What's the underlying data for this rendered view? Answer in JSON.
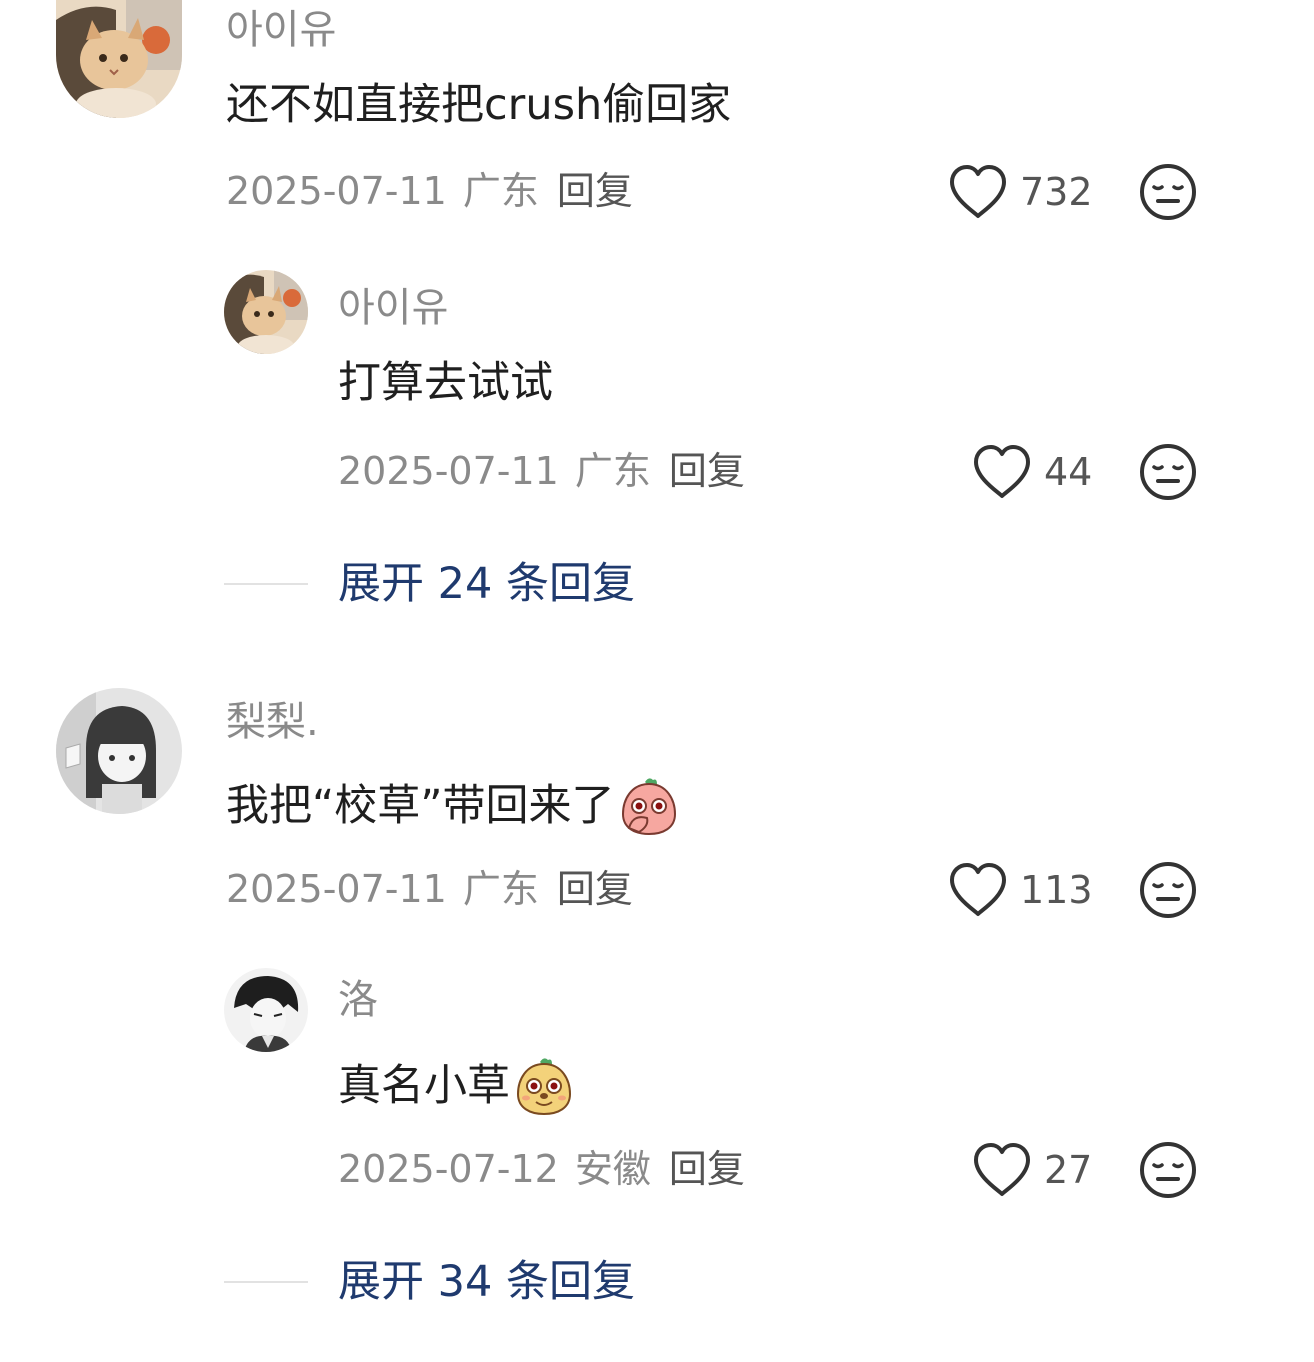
{
  "comments": [
    {
      "username": "아이유",
      "text": "还不如直接把crush偷回家",
      "date": "2025-07-11",
      "location": "广东",
      "reply_label": "回复",
      "likes": "732",
      "replies": [
        {
          "username": "아이유",
          "text": "打算去试试",
          "date": "2025-07-11",
          "location": "广东",
          "reply_label": "回复",
          "likes": "44"
        }
      ],
      "expand_label": "展开 24 条回复"
    },
    {
      "username": "梨梨.",
      "text": "我把“校草”带回来了",
      "emoji": "peach-cover-mouth-emoji",
      "date": "2025-07-11",
      "location": "广东",
      "reply_label": "回复",
      "likes": "113",
      "replies": [
        {
          "username": "洛",
          "text": "真名小草",
          "emoji": "potato-smile-emoji",
          "date": "2025-07-12",
          "location": "安徽",
          "reply_label": "回复",
          "likes": "27"
        }
      ],
      "expand_label": "展开 34 条回复"
    }
  ],
  "colors": {
    "username": "#8a8a8a",
    "text": "#1f1f1f",
    "meta": "#8a8a8a",
    "reply_link": "#555555",
    "expand_link": "#1f3a6e"
  },
  "icons": {
    "like": "heart-outline-icon",
    "dislike": "neutral-face-icon"
  }
}
